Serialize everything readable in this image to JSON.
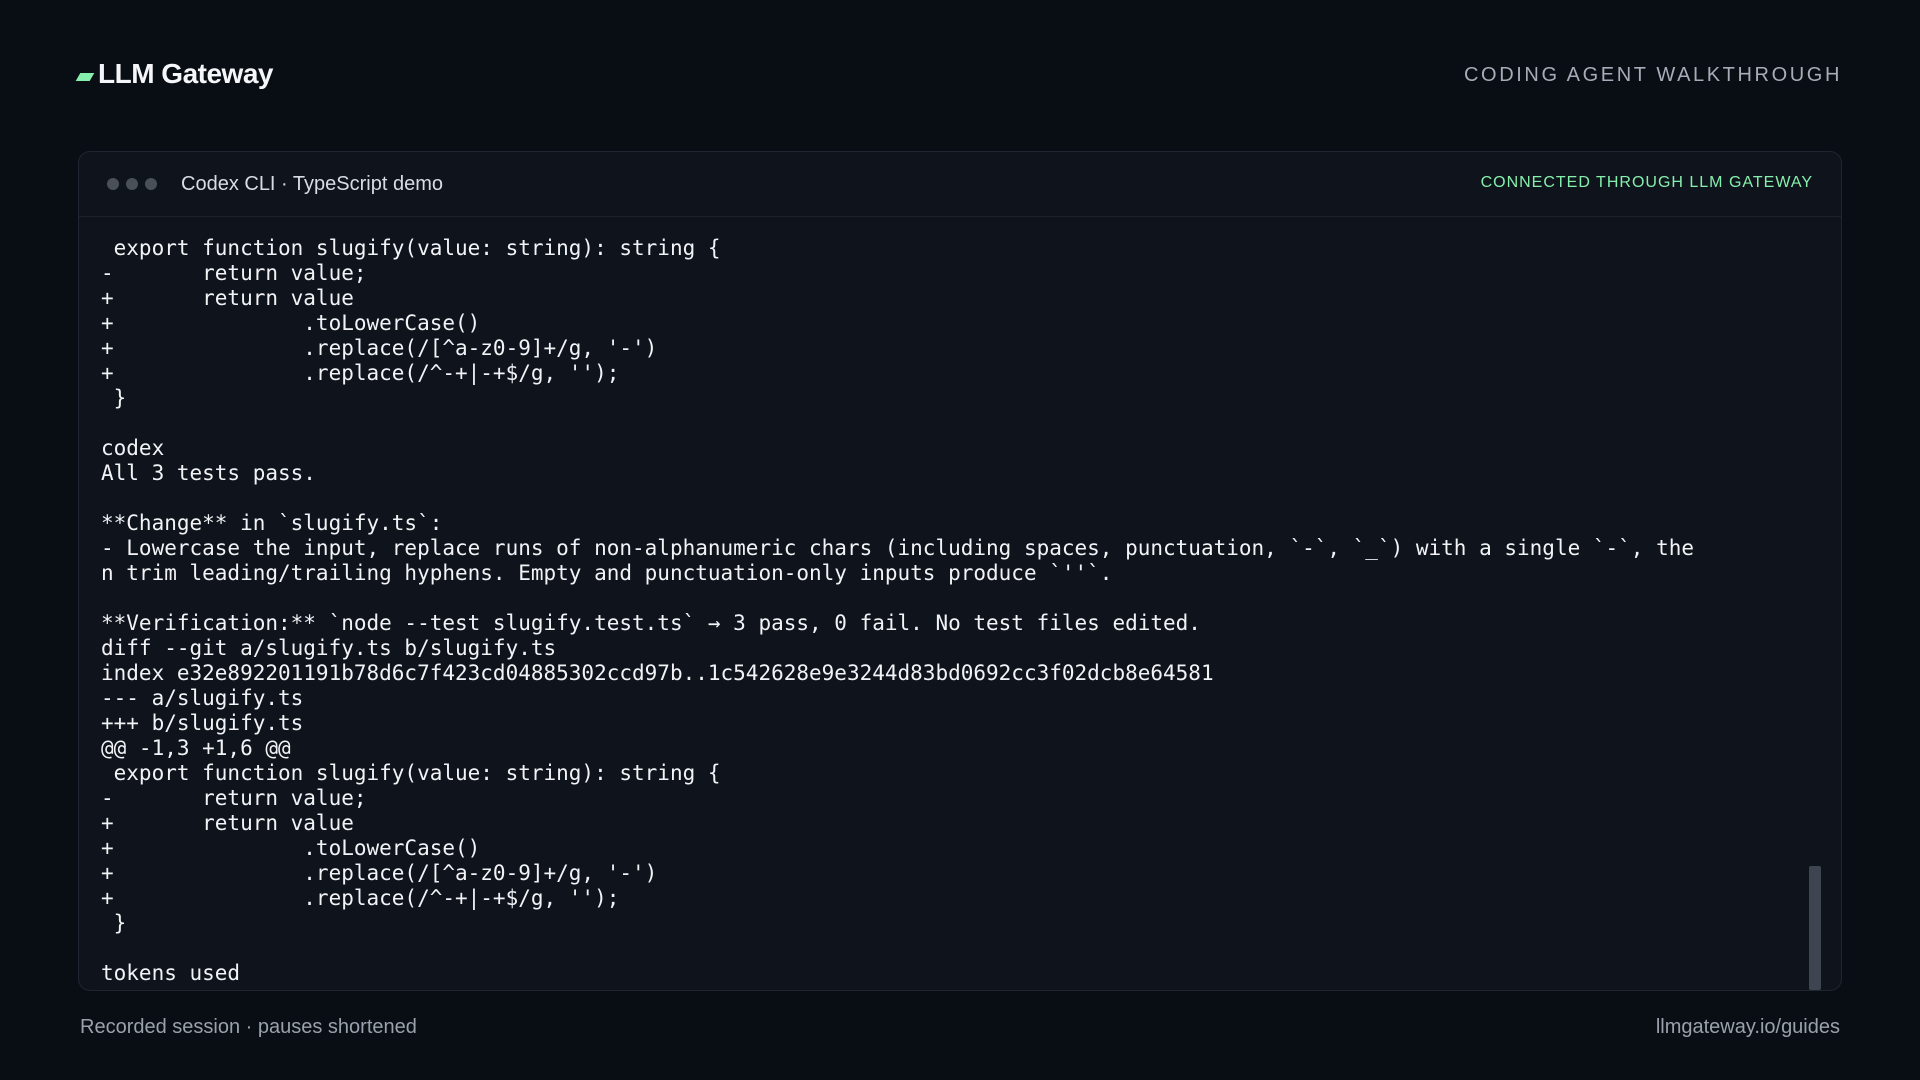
{
  "brand": {
    "name": "LLM Gateway",
    "accent": "#86efac"
  },
  "header": {
    "tag": "CODING AGENT WALKTHROUGH"
  },
  "window": {
    "title": "Codex CLI · TypeScript demo",
    "badge": "CONNECTED THROUGH LLM GATEWAY"
  },
  "terminal": {
    "lines": [
      " export function slugify(value: string): string {",
      "-       return value;",
      "+       return value",
      "+               .toLowerCase()",
      "+               .replace(/[^a-z0-9]+/g, '-')",
      "+               .replace(/^-+|-+$/g, '');",
      " }",
      "",
      "codex",
      "All 3 tests pass.",
      "",
      "**Change** in `slugify.ts`:",
      "- Lowercase the input, replace runs of non-alphanumeric chars (including spaces, punctuation, `-`, `_`) with a single `-`, the",
      "n trim leading/trailing hyphens. Empty and punctuation-only inputs produce `''`.",
      "",
      "**Verification:** `node --test slugify.test.ts` → 3 pass, 0 fail. No test files edited.",
      "diff --git a/slugify.ts b/slugify.ts",
      "index e32e892201191b78d6c7f423cd04885302ccd97b..1c542628e9e3244d83bd0692cc3f02dcb8e64581",
      "--- a/slugify.ts",
      "+++ b/slugify.ts",
      "@@ -1,3 +1,6 @@",
      " export function slugify(value: string): string {",
      "-       return value;",
      "+       return value",
      "+               .toLowerCase()",
      "+               .replace(/[^a-z0-9]+/g, '-')",
      "+               .replace(/^-+|-+$/g, '');",
      " }",
      "",
      "tokens used"
    ]
  },
  "footer": {
    "left": "Recorded session · pauses shortened",
    "right": "llmgateway.io/guides"
  }
}
